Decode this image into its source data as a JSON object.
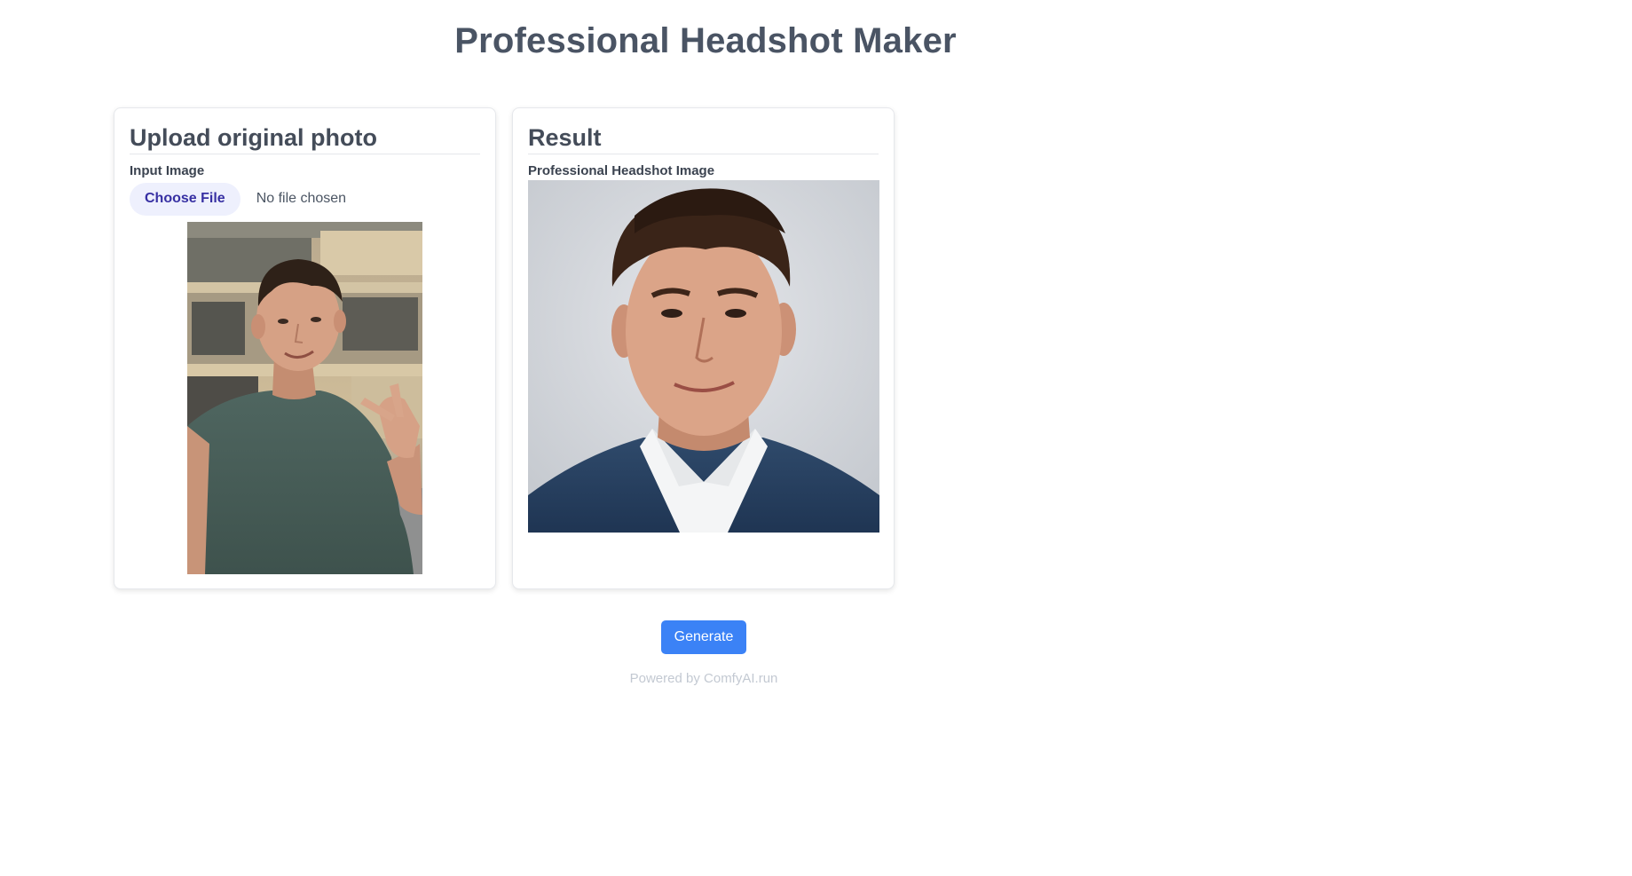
{
  "app": {
    "title": "Professional Headshot Maker"
  },
  "upload_panel": {
    "heading": "Upload original photo",
    "field_label": "Input Image",
    "choose_file_label": "Choose File",
    "file_status": "No file chosen",
    "image_alt": "selfie-photo"
  },
  "result_panel": {
    "heading": "Result",
    "field_label": "Professional Headshot Image",
    "image_alt": "headshot-photo"
  },
  "actions": {
    "generate_label": "Generate"
  },
  "footer": {
    "prefix": "Powered by ",
    "brand": "ComfyAI.run"
  },
  "colors": {
    "primary_button": "#3b82f6",
    "file_button_bg": "#eef0fd",
    "file_button_text": "#3730a3",
    "title_text": "#4a5464",
    "footer_text": "#c3c9d2"
  }
}
